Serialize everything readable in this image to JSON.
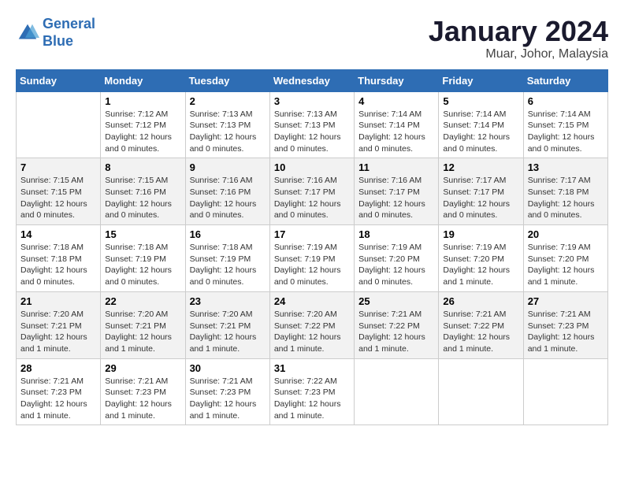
{
  "header": {
    "logo_line1": "General",
    "logo_line2": "Blue",
    "title": "January 2024",
    "subtitle": "Muar, Johor, Malaysia"
  },
  "weekdays": [
    "Sunday",
    "Monday",
    "Tuesday",
    "Wednesday",
    "Thursday",
    "Friday",
    "Saturday"
  ],
  "weeks": [
    [
      {
        "day": "",
        "info": ""
      },
      {
        "day": "1",
        "info": "Sunrise: 7:12 AM\nSunset: 7:12 PM\nDaylight: 12 hours\nand 0 minutes."
      },
      {
        "day": "2",
        "info": "Sunrise: 7:13 AM\nSunset: 7:13 PM\nDaylight: 12 hours\nand 0 minutes."
      },
      {
        "day": "3",
        "info": "Sunrise: 7:13 AM\nSunset: 7:13 PM\nDaylight: 12 hours\nand 0 minutes."
      },
      {
        "day": "4",
        "info": "Sunrise: 7:14 AM\nSunset: 7:14 PM\nDaylight: 12 hours\nand 0 minutes."
      },
      {
        "day": "5",
        "info": "Sunrise: 7:14 AM\nSunset: 7:14 PM\nDaylight: 12 hours\nand 0 minutes."
      },
      {
        "day": "6",
        "info": "Sunrise: 7:14 AM\nSunset: 7:15 PM\nDaylight: 12 hours\nand 0 minutes."
      }
    ],
    [
      {
        "day": "7",
        "info": "Sunrise: 7:15 AM\nSunset: 7:15 PM\nDaylight: 12 hours\nand 0 minutes."
      },
      {
        "day": "8",
        "info": "Sunrise: 7:15 AM\nSunset: 7:16 PM\nDaylight: 12 hours\nand 0 minutes."
      },
      {
        "day": "9",
        "info": "Sunrise: 7:16 AM\nSunset: 7:16 PM\nDaylight: 12 hours\nand 0 minutes."
      },
      {
        "day": "10",
        "info": "Sunrise: 7:16 AM\nSunset: 7:17 PM\nDaylight: 12 hours\nand 0 minutes."
      },
      {
        "day": "11",
        "info": "Sunrise: 7:16 AM\nSunset: 7:17 PM\nDaylight: 12 hours\nand 0 minutes."
      },
      {
        "day": "12",
        "info": "Sunrise: 7:17 AM\nSunset: 7:17 PM\nDaylight: 12 hours\nand 0 minutes."
      },
      {
        "day": "13",
        "info": "Sunrise: 7:17 AM\nSunset: 7:18 PM\nDaylight: 12 hours\nand 0 minutes."
      }
    ],
    [
      {
        "day": "14",
        "info": "Sunrise: 7:18 AM\nSunset: 7:18 PM\nDaylight: 12 hours\nand 0 minutes."
      },
      {
        "day": "15",
        "info": "Sunrise: 7:18 AM\nSunset: 7:19 PM\nDaylight: 12 hours\nand 0 minutes."
      },
      {
        "day": "16",
        "info": "Sunrise: 7:18 AM\nSunset: 7:19 PM\nDaylight: 12 hours\nand 0 minutes."
      },
      {
        "day": "17",
        "info": "Sunrise: 7:19 AM\nSunset: 7:19 PM\nDaylight: 12 hours\nand 0 minutes."
      },
      {
        "day": "18",
        "info": "Sunrise: 7:19 AM\nSunset: 7:20 PM\nDaylight: 12 hours\nand 0 minutes."
      },
      {
        "day": "19",
        "info": "Sunrise: 7:19 AM\nSunset: 7:20 PM\nDaylight: 12 hours\nand 1 minute."
      },
      {
        "day": "20",
        "info": "Sunrise: 7:19 AM\nSunset: 7:20 PM\nDaylight: 12 hours\nand 1 minute."
      }
    ],
    [
      {
        "day": "21",
        "info": "Sunrise: 7:20 AM\nSunset: 7:21 PM\nDaylight: 12 hours\nand 1 minute."
      },
      {
        "day": "22",
        "info": "Sunrise: 7:20 AM\nSunset: 7:21 PM\nDaylight: 12 hours\nand 1 minute."
      },
      {
        "day": "23",
        "info": "Sunrise: 7:20 AM\nSunset: 7:21 PM\nDaylight: 12 hours\nand 1 minute."
      },
      {
        "day": "24",
        "info": "Sunrise: 7:20 AM\nSunset: 7:22 PM\nDaylight: 12 hours\nand 1 minute."
      },
      {
        "day": "25",
        "info": "Sunrise: 7:21 AM\nSunset: 7:22 PM\nDaylight: 12 hours\nand 1 minute."
      },
      {
        "day": "26",
        "info": "Sunrise: 7:21 AM\nSunset: 7:22 PM\nDaylight: 12 hours\nand 1 minute."
      },
      {
        "day": "27",
        "info": "Sunrise: 7:21 AM\nSunset: 7:23 PM\nDaylight: 12 hours\nand 1 minute."
      }
    ],
    [
      {
        "day": "28",
        "info": "Sunrise: 7:21 AM\nSunset: 7:23 PM\nDaylight: 12 hours\nand 1 minute."
      },
      {
        "day": "29",
        "info": "Sunrise: 7:21 AM\nSunset: 7:23 PM\nDaylight: 12 hours\nand 1 minute."
      },
      {
        "day": "30",
        "info": "Sunrise: 7:21 AM\nSunset: 7:23 PM\nDaylight: 12 hours\nand 1 minute."
      },
      {
        "day": "31",
        "info": "Sunrise: 7:22 AM\nSunset: 7:23 PM\nDaylight: 12 hours\nand 1 minute."
      },
      {
        "day": "",
        "info": ""
      },
      {
        "day": "",
        "info": ""
      },
      {
        "day": "",
        "info": ""
      }
    ]
  ]
}
